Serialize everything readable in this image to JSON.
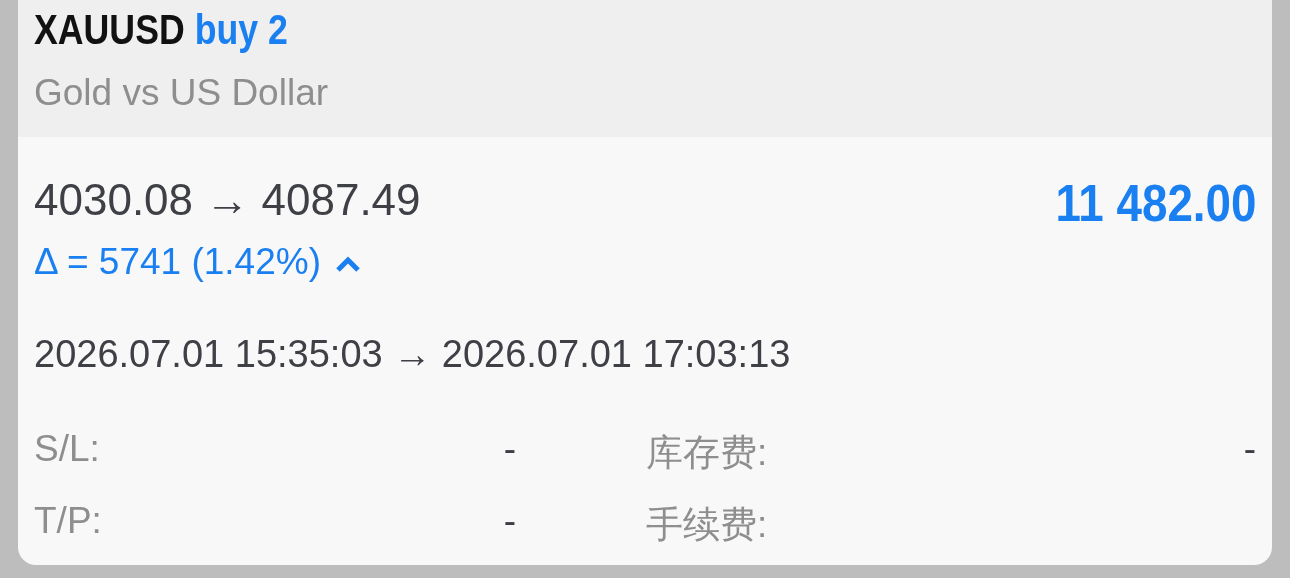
{
  "header": {
    "symbol": "XAUUSD",
    "side": "buy 2",
    "description": "Gold vs US Dollar"
  },
  "prices": "4030.08 → 4087.49",
  "profit": "11 482.00",
  "delta": "Δ = 5741 (1.42%)",
  "rising": true,
  "times": "2026.07.01 15:35:03 → 2026.07.01 17:03:13",
  "details": [
    {
      "label": "S/L:",
      "value": "-",
      "label2": "库存费:",
      "value2": "-"
    },
    {
      "label": "T/P:",
      "value": "-",
      "label2": "手续费:"
    }
  ]
}
